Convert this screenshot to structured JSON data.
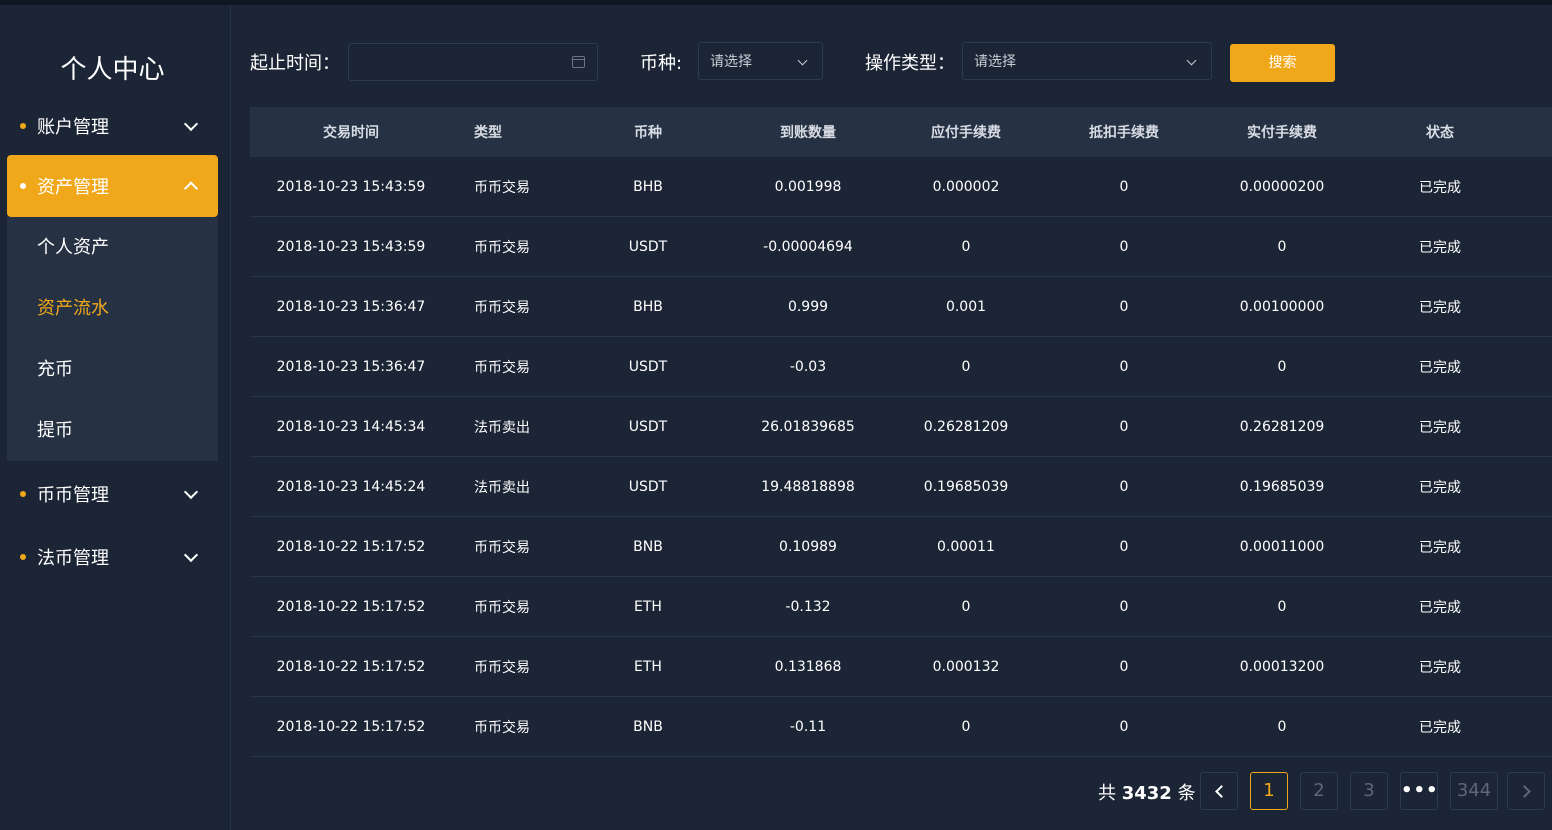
{
  "sidebar": {
    "title": "个人中心",
    "menu": [
      {
        "label": "账户管理"
      },
      {
        "label": "资产管理"
      },
      {
        "label": "币币管理"
      },
      {
        "label": "法币管理"
      }
    ],
    "submenu": [
      {
        "label": "个人资产"
      },
      {
        "label": "资产流水"
      },
      {
        "label": "充币"
      },
      {
        "label": "提币"
      }
    ]
  },
  "filters": {
    "date_label": "起止时间：",
    "date_value": "",
    "coin_label": "币种:",
    "coin_placeholder": "请选择",
    "type_label": "操作类型：",
    "type_placeholder": "请选择",
    "search_label": "搜索"
  },
  "table": {
    "headers": [
      "交易时间",
      "类型",
      "币种",
      "到账数量",
      "应付手续费",
      "抵扣手续费",
      "实付手续费",
      "状态"
    ],
    "rows": [
      [
        "2018-10-23 15:43:59",
        "币币交易",
        "BHB",
        "0.001998",
        "0.000002",
        "0",
        "0.00000200",
        "已完成"
      ],
      [
        "2018-10-23 15:43:59",
        "币币交易",
        "USDT",
        "-0.00004694",
        "0",
        "0",
        "0",
        "已完成"
      ],
      [
        "2018-10-23 15:36:47",
        "币币交易",
        "BHB",
        "0.999",
        "0.001",
        "0",
        "0.00100000",
        "已完成"
      ],
      [
        "2018-10-23 15:36:47",
        "币币交易",
        "USDT",
        "-0.03",
        "0",
        "0",
        "0",
        "已完成"
      ],
      [
        "2018-10-23 14:45:34",
        "法币卖出",
        "USDT",
        "26.01839685",
        "0.26281209",
        "0",
        "0.26281209",
        "已完成"
      ],
      [
        "2018-10-23 14:45:24",
        "法币卖出",
        "USDT",
        "19.48818898",
        "0.19685039",
        "0",
        "0.19685039",
        "已完成"
      ],
      [
        "2018-10-22 15:17:52",
        "币币交易",
        "BNB",
        "0.10989",
        "0.00011",
        "0",
        "0.00011000",
        "已完成"
      ],
      [
        "2018-10-22 15:17:52",
        "币币交易",
        "ETH",
        "-0.132",
        "0",
        "0",
        "0",
        "已完成"
      ],
      [
        "2018-10-22 15:17:52",
        "币币交易",
        "ETH",
        "0.131868",
        "0.000132",
        "0",
        "0.00013200",
        "已完成"
      ],
      [
        "2018-10-22 15:17:52",
        "币币交易",
        "BNB",
        "-0.11",
        "0",
        "0",
        "0",
        "已完成"
      ]
    ]
  },
  "pagination": {
    "total_prefix": "共",
    "total_count": "3432",
    "total_suffix": "条",
    "pages": [
      "1",
      "2",
      "3"
    ],
    "ellipsis": "•••",
    "last_page": "344",
    "current": "1"
  },
  "colors": {
    "accent": "#f0a81a",
    "background": "#1b2535",
    "header_bg": "#263244"
  },
  "icons": {
    "calendar": "calendar-icon",
    "chevron_down": "chevron-down-icon",
    "chevron_up": "chevron-up-icon",
    "prev": "chevron-left-icon",
    "next": "chevron-right-icon"
  }
}
